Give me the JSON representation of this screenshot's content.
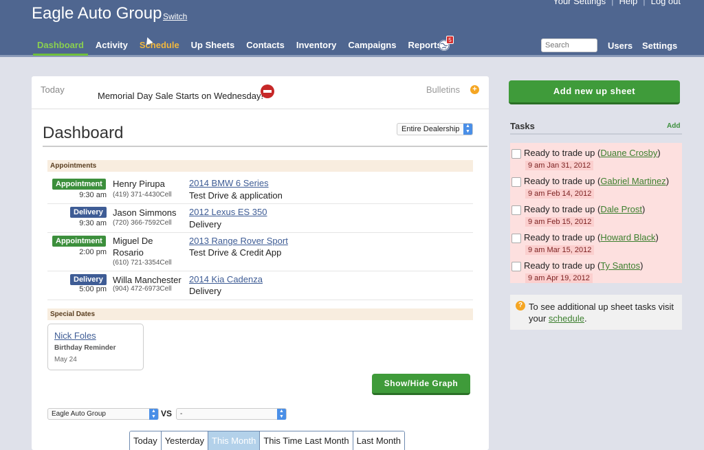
{
  "header": {
    "brand": "Eagle Auto Group",
    "switch": "Switch",
    "top_links": [
      "Your Settings",
      "Help",
      "Log out"
    ],
    "nav": [
      "Dashboard",
      "Activity",
      "Schedule",
      "Up Sheets",
      "Contacts",
      "Inventory",
      "Campaigns",
      "Reports"
    ],
    "notifications": "5",
    "search_placeholder": "Search",
    "users": "Users",
    "settings": "Settings"
  },
  "bulletin": {
    "today": "Today",
    "text": "Memorial Day Sale Starts on Wednesday!",
    "bulletins": "Bulletins"
  },
  "dashboard": {
    "title": "Dashboard",
    "scope": "Entire Dealership",
    "appointments_label": "Appointments",
    "appointments": [
      {
        "type": "Appointment",
        "time": "9:30 am",
        "name": "Henry Pirupa",
        "phone": "(419) 371-4430Cell",
        "vehicle": "2014 BMW 6 Series",
        "purpose": "Test Drive & application"
      },
      {
        "type": "Delivery",
        "time": "9:30 am",
        "name": "Jason Simmons",
        "phone": "(720) 366-7592Cell",
        "vehicle": "2012 Lexus ES 350",
        "purpose": "Delivery"
      },
      {
        "type": "Appointment",
        "time": "2:00 pm",
        "name": "Miguel De Rosario",
        "phone": "(610) 721-3354Cell",
        "vehicle": "2013 Range Rover Sport",
        "purpose": "Test Drive & Credit App"
      },
      {
        "type": "Delivery",
        "time": "5:00 pm",
        "name": "Willa Manchester",
        "phone": "(904) 472-6973Cell",
        "vehicle": "2014 Kia Cadenza",
        "purpose": "Delivery"
      }
    ],
    "special_dates_label": "Special Dates",
    "special_date": {
      "name": "Nick Foles",
      "type": "Birthday Reminder",
      "date": "May 24"
    },
    "graph_button": "Show/Hide Graph",
    "compare_left": "Eagle Auto Group",
    "vs": "VS",
    "compare_right": "-",
    "periods": [
      "Today",
      "Yesterday",
      "This Month",
      "This Time Last Month",
      "Last Month"
    ],
    "active_period": "This Month"
  },
  "sidebar": {
    "add_button": "Add new up sheet",
    "tasks_title": "Tasks",
    "tasks_add": "Add",
    "task_prefix": "Ready to trade up",
    "tasks": [
      {
        "contact": "Duane Crosby",
        "date": "9 am Jan 31, 2012"
      },
      {
        "contact": "Gabriel Martinez",
        "date": "9 am Feb 14, 2012"
      },
      {
        "contact": "Dale Prost",
        "date": "9 am Feb 15, 2012"
      },
      {
        "contact": "Howard Black",
        "date": "9 am Mar 15, 2012"
      },
      {
        "contact": "Ty Santos",
        "date": "9 am Apr 19, 2012"
      }
    ],
    "info_text": "To see additional up sheet tasks visit your",
    "info_link": "schedule",
    "info_end": "."
  }
}
